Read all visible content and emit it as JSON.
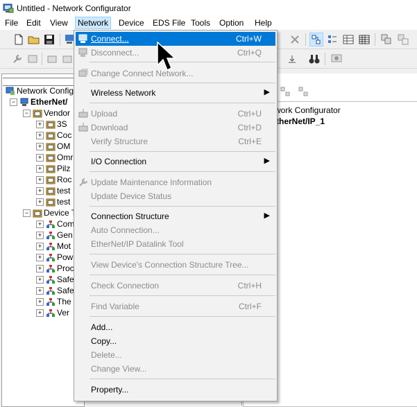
{
  "window": {
    "title": "Untitled - Network Configurator"
  },
  "menubar": {
    "items": [
      {
        "label": "File"
      },
      {
        "label": "Edit"
      },
      {
        "label": "View"
      },
      {
        "label": "Network"
      },
      {
        "label": "Device"
      },
      {
        "label": "EDS File"
      },
      {
        "label": "Tools"
      },
      {
        "label": "Option"
      },
      {
        "label": "Help"
      }
    ]
  },
  "tree": {
    "root": "Network Configur",
    "network": "EtherNet/",
    "vendor_group": "Vendor",
    "vendors": [
      "3S",
      "Coc",
      "OM",
      "Omr",
      "Pilz",
      "Roc",
      "test",
      "test"
    ],
    "device_type_group": "Device T",
    "device_types": [
      "Com",
      "Gen",
      "Mot",
      "Pow",
      "Proc",
      "Safe",
      "Safe",
      "The",
      "Ver"
    ]
  },
  "right_pane": {
    "header": "work Configurator",
    "network_name": "therNet/IP_1"
  },
  "network_menu": {
    "items": [
      {
        "label": "Connect...",
        "shortcut": "Ctrl+W",
        "state": "selected"
      },
      {
        "label": "Disconnect...",
        "shortcut": "Ctrl+Q",
        "state": "disabled"
      },
      {
        "label": "Change Connect Network...",
        "shortcut": "",
        "state": "disabled"
      },
      {
        "label": "Wireless Network",
        "shortcut": "",
        "state": "enabled"
      },
      {
        "label": "Upload",
        "shortcut": "Ctrl+U",
        "state": "disabled"
      },
      {
        "label": "Download",
        "shortcut": "Ctrl+D",
        "state": "disabled"
      },
      {
        "label": "Verify Structure",
        "shortcut": "Ctrl+E",
        "state": "disabled"
      },
      {
        "label": "I/O Connection",
        "shortcut": "",
        "state": "enabled"
      },
      {
        "label": "Update Maintenance Information",
        "shortcut": "",
        "state": "disabled"
      },
      {
        "label": "Update Device Status",
        "shortcut": "",
        "state": "disabled"
      },
      {
        "label": "Connection Structure",
        "shortcut": "",
        "state": "enabled"
      },
      {
        "label": "Auto Connection...",
        "shortcut": "",
        "state": "disabled"
      },
      {
        "label": "EtherNet/IP Datalink Tool",
        "shortcut": "",
        "state": "disabled"
      },
      {
        "label": "View Device's Connection Structure Tree...",
        "shortcut": "",
        "state": "disabled"
      },
      {
        "label": "Check Connection",
        "shortcut": "Ctrl+H",
        "state": "disabled"
      },
      {
        "label": "Find Variable",
        "shortcut": "Ctrl+F",
        "state": "disabled"
      },
      {
        "label": "Add...",
        "shortcut": "",
        "state": "enabled"
      },
      {
        "label": "Copy...",
        "shortcut": "",
        "state": "enabled"
      },
      {
        "label": "Delete...",
        "shortcut": "",
        "state": "disabled"
      },
      {
        "label": "Change View...",
        "shortcut": "",
        "state": "disabled"
      },
      {
        "label": "Property...",
        "shortcut": "",
        "state": "enabled"
      }
    ]
  },
  "colors": {
    "highlight": "#0078d7",
    "disabled_text": "#8c8c8c",
    "menu_bg": "#f2f2f2"
  }
}
